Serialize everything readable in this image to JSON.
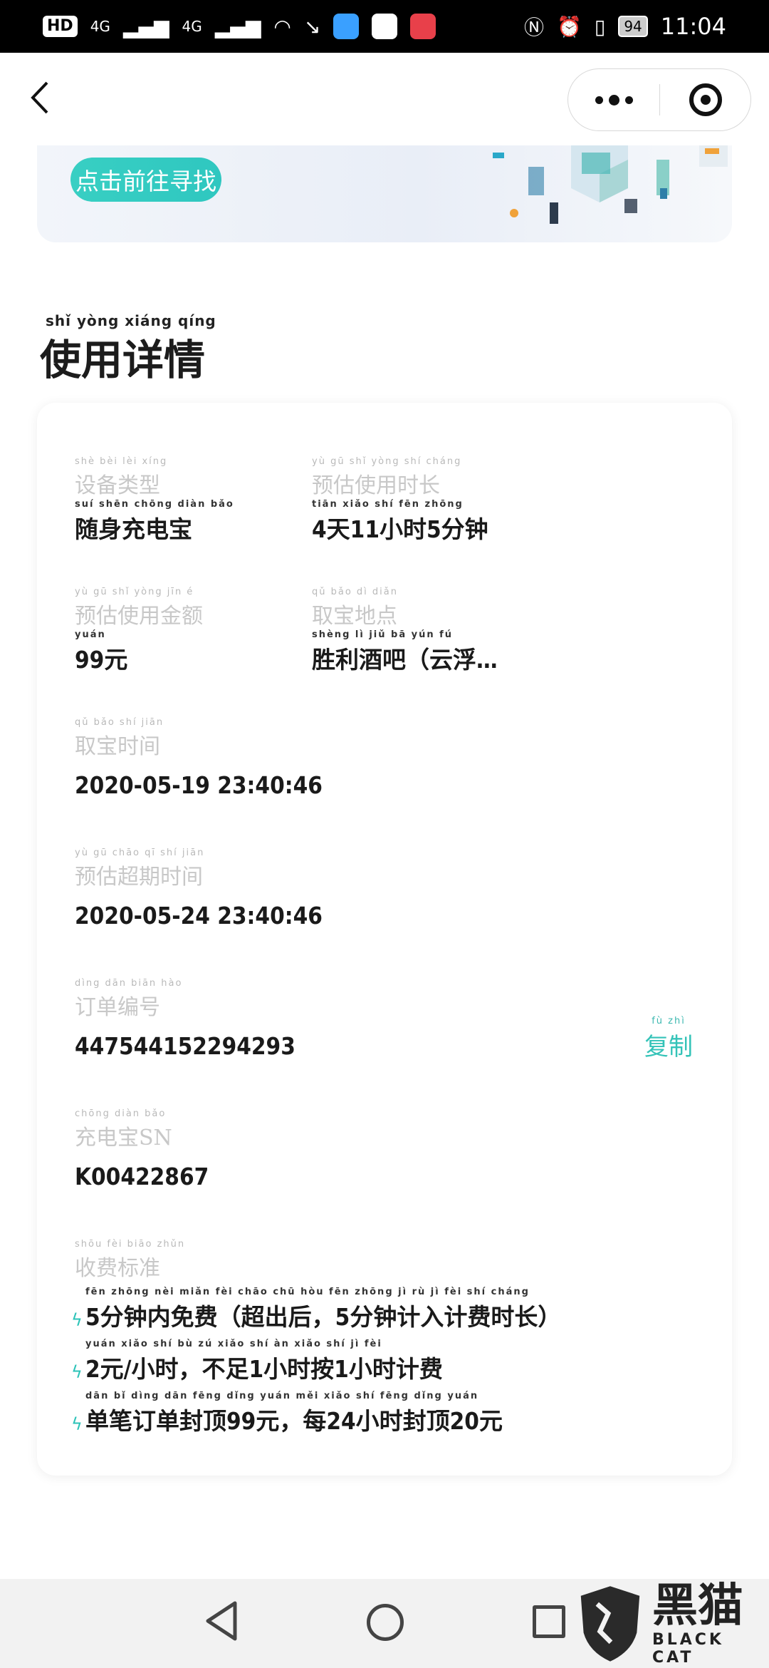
{
  "status_bar": {
    "hd_label": "HD",
    "signal_1": "4G",
    "signal_2": "4G",
    "battery": "94",
    "time": "11:04"
  },
  "nav": {
    "back_icon": "chevron-left-icon",
    "more_icon": "more-dots-icon",
    "close_icon": "target-circle-icon"
  },
  "banner": {
    "button_label": "点击前往寻找"
  },
  "section": {
    "pinyin": "shǐ  yòng xiáng qíng",
    "title": "使用详情"
  },
  "details": {
    "device_type": {
      "label_py": "shè  bèi  lèi  xíng",
      "label": "设备类型",
      "value_py": "suí shēn chōng diàn bǎo",
      "value": "随身充电宝"
    },
    "est_duration": {
      "label_py": "yù  gū  shǐ yòng shí cháng",
      "label": "预估使用时长",
      "value_py": "tiān         xiǎo  shí       fēn zhōng",
      "value": "4天11小时5分钟"
    },
    "est_amount": {
      "label_py": "yù  gū  shǐ yòng jīn   é",
      "label": "预估使用金额",
      "value_py": "     yuán",
      "value": "99元"
    },
    "pickup_location": {
      "label_py": "qǔ  bǎo  dì  diǎn",
      "label": "取宝地点",
      "value_py": "shèng  lì   jiǔ   bā    yún  fú",
      "value": "胜利酒吧（云浮…"
    },
    "pickup_time": {
      "label_py": "qǔ  bǎo  shí  jiān",
      "label": "取宝时间",
      "value": "2020-05-19 23:40:46"
    },
    "est_overdue_time": {
      "label_py": "yù  gū chāo  qī  shí  jiān",
      "label": "预估超期时间",
      "value": "2020-05-24 23:40:46"
    },
    "order_no": {
      "label_py": "dìng dān biān hào",
      "label": "订单编号",
      "value": "447544152294293"
    },
    "copy": {
      "label_py": "fù   zhì",
      "label": "复制"
    },
    "power_bank_sn": {
      "label_py": "chōng diàn bǎo",
      "label": "充电宝SN",
      "value": "K00422867"
    },
    "fee_standard": {
      "label_py": "shōu  fèi biāo zhǔn",
      "label": "收费标准"
    }
  },
  "fee_rules": [
    {
      "pinyin": "  fēn zhōng nèi miǎn fèi       chāo chū hòu         fēn zhōng  jì   rù   jì   fèi  shí cháng",
      "text": "5分钟内免费（超出后，5分钟计入计费时长）"
    },
    {
      "pinyin": "   yuán    xiǎo  shí      bù   zú      xiǎo  shí  àn      xiǎo  shí  jì   fèi",
      "text": "2元/小时，不足1小时按1小时计费"
    },
    {
      "pinyin": "dān  bǐ  dìng dān fēng dǐng       yuán      měi       xiǎo  shí fēng dǐng       yuán",
      "text": "单笔订单封顶99元，每24小时封顶20元"
    }
  ],
  "watermark": {
    "cn": "黑猫",
    "en": "BLACK CAT"
  },
  "colors": {
    "accent": "#2fc7c0",
    "label_gray": "#c8c8c8",
    "value_dark": "#1a1a1a"
  }
}
